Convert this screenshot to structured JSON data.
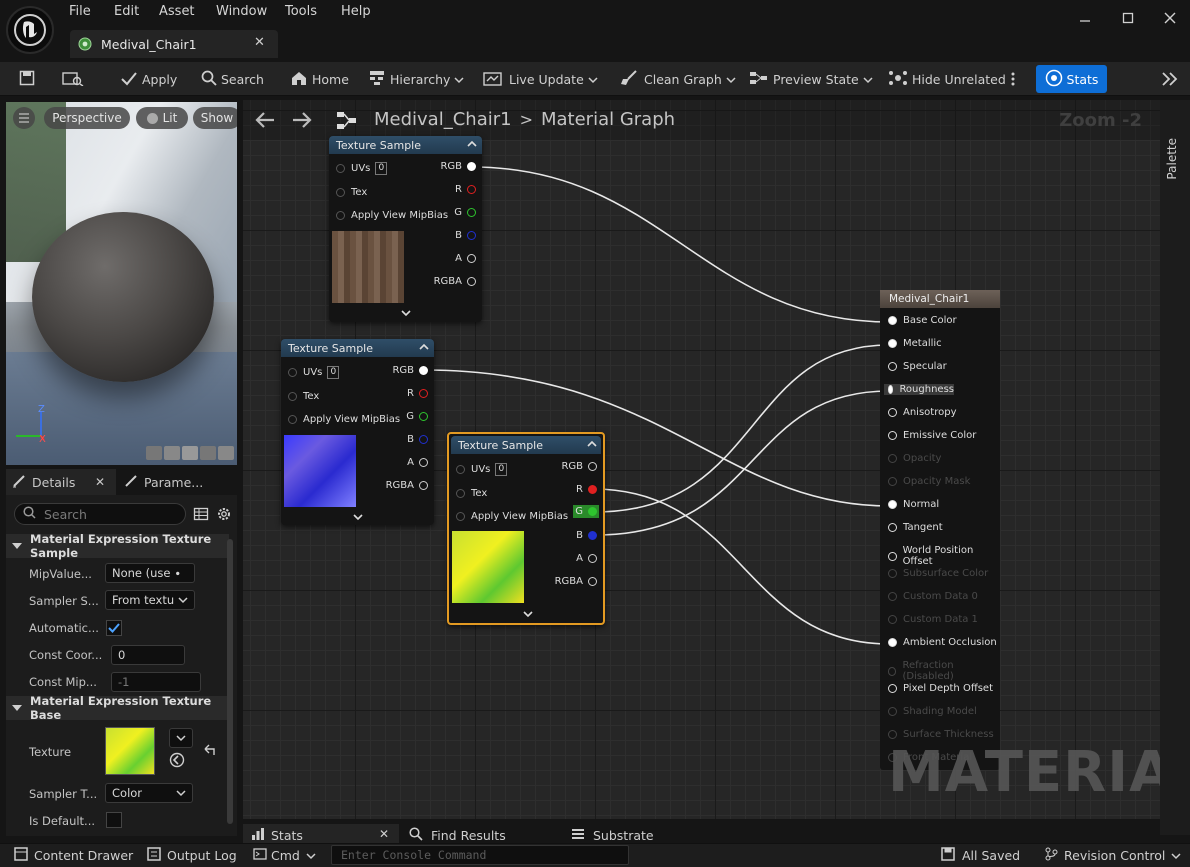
{
  "menu": [
    "File",
    "Edit",
    "Asset",
    "Window",
    "Tools",
    "Help"
  ],
  "asset_tab": {
    "label": "Medival_Chair1"
  },
  "toolbar": {
    "apply": "Apply",
    "search": "Search",
    "home": "Home",
    "hierarchy": "Hierarchy",
    "live_update": "Live Update",
    "clean_graph": "Clean Graph",
    "preview_state": "Preview State",
    "hide_unrelated": "Hide Unrelated",
    "stats": "Stats"
  },
  "viewport": {
    "perspective": "Perspective",
    "lit": "Lit",
    "show": "Show",
    "axis_z": "Z",
    "axis_x": "X",
    "axis_y": "Y"
  },
  "details": {
    "tab_details": "Details",
    "tab_params": "Parame...",
    "search_placeholder": "Search",
    "section1": "Material Expression Texture Sample",
    "section2": "Material Expression Texture Base",
    "props": [
      {
        "label": "MipValue...",
        "value": "None (use ∙"
      },
      {
        "label": "Sampler S...",
        "value": "From textu"
      },
      {
        "label": "Automatic...",
        "value": ""
      },
      {
        "label": "Const Coor...",
        "value": "0"
      },
      {
        "label": "Const Mip...",
        "value": "-1"
      }
    ],
    "texture_label": "Texture",
    "sampler_type_label": "Sampler T...",
    "sampler_type_value": "Color",
    "is_default_label": "Is Default..."
  },
  "graph": {
    "breadcrumb_asset": "Medival_Chair1",
    "breadcrumb_sep": ">",
    "breadcrumb_graph": "Material Graph",
    "zoom": "Zoom -2",
    "watermark": "MATERIAL",
    "texture_nodes": [
      {
        "title": "Texture Sample",
        "uvs": "UVs",
        "uv_value": "0",
        "tex": "Tex",
        "mip": "Apply View MipBias",
        "outputs": [
          "RGB",
          "R",
          "G",
          "B",
          "A",
          "RGBA"
        ]
      },
      {
        "title": "Texture Sample",
        "uvs": "UVs",
        "uv_value": "0",
        "tex": "Tex",
        "mip": "Apply View MipBias",
        "outputs": [
          "RGB",
          "R",
          "G",
          "B",
          "A",
          "RGBA"
        ]
      },
      {
        "title": "Texture Sample",
        "uvs": "UVs",
        "uv_value": "0",
        "tex": "Tex",
        "mip": "Apply View MipBias",
        "outputs": [
          "RGB",
          "R",
          "G",
          "B",
          "A",
          "RGBA"
        ]
      }
    ],
    "material_node": {
      "title": "Medival_Chair1",
      "pins": [
        "Base Color",
        "Metallic",
        "Specular",
        "Roughness",
        "Anisotropy",
        "Emissive Color",
        "Opacity",
        "Opacity Mask",
        "Normal",
        "Tangent",
        "World Position Offset",
        "Subsurface Color",
        "Custom Data 0",
        "Custom Data 1",
        "Ambient Occlusion",
        "Refraction (Disabled)",
        "Pixel Depth Offset",
        "Shading Model",
        "Surface Thickness",
        "Front Material"
      ],
      "disabled": [
        6,
        7,
        11,
        12,
        13,
        15,
        17,
        18,
        19
      ]
    }
  },
  "palette": "Palette",
  "bottom_tabs": {
    "stats": "Stats",
    "find_results": "Find Results",
    "substrate": "Substrate"
  },
  "statusbar": {
    "content_drawer": "Content Drawer",
    "output_log": "Output Log",
    "cmd": "Cmd",
    "console_placeholder": "Enter Console Command",
    "all_saved": "All Saved",
    "revision_control": "Revision Control"
  },
  "colors": {
    "accent": "#0e6ed6",
    "selected_node": "#e39a22",
    "wire": "#e8e8e8",
    "red_pin": "#e02020",
    "green_pin": "#2ec42e",
    "blue_pin": "#2030d0"
  }
}
